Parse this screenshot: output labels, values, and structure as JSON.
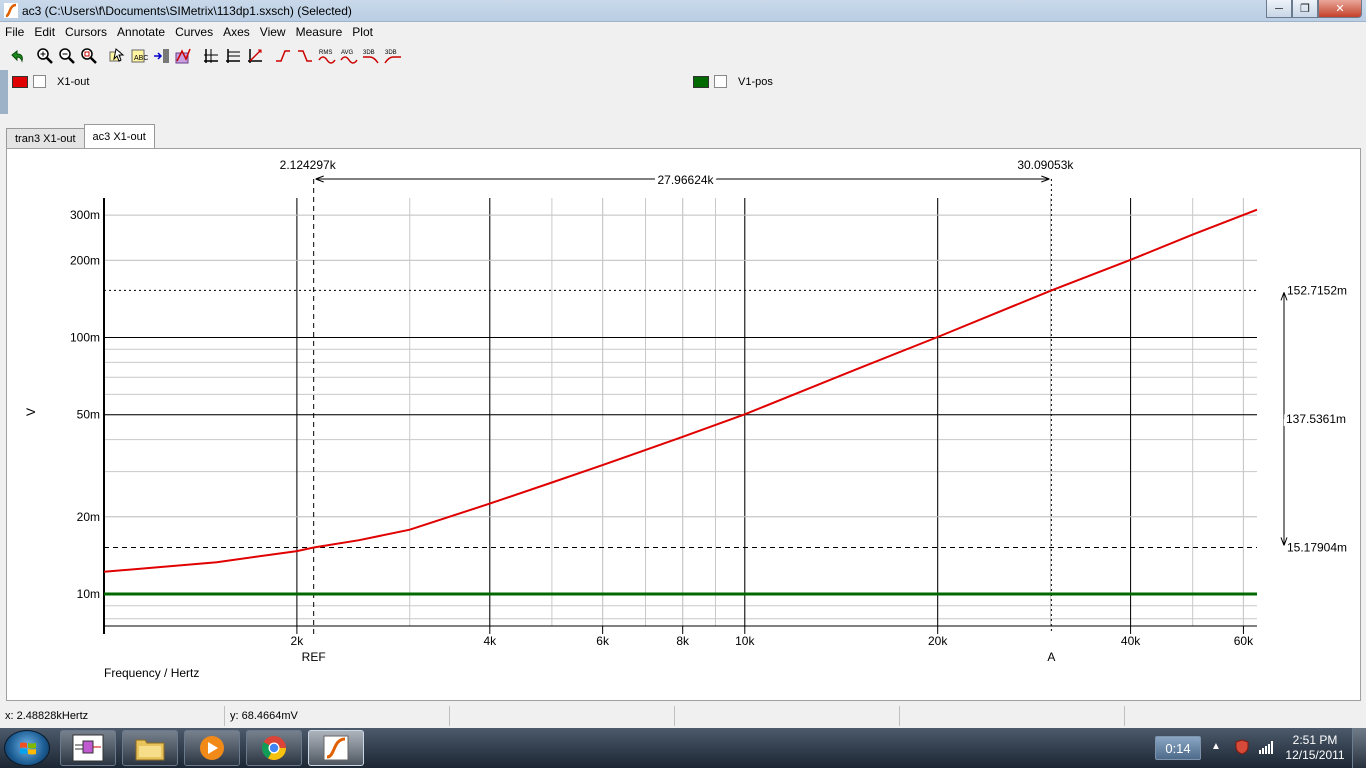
{
  "window": {
    "title": "ac3 (C:\\Users\\f\\Documents\\SIMetrix\\113dp1.sxsch) (Selected)",
    "min_label": "─",
    "max_label": "❐",
    "close_label": "✕"
  },
  "menu": [
    "File",
    "Edit",
    "Cursors",
    "Annotate",
    "Curves",
    "Axes",
    "View",
    "Measure",
    "Plot"
  ],
  "toolbar": {
    "icons": [
      "undo-icon",
      "zoom-in-icon",
      "zoom-out-icon",
      "zoom-fit-icon",
      "select-icon",
      "label-icon",
      "insert-icon",
      "axis-icon",
      "grid-icon",
      "log-icon",
      "cursor-icon",
      "rise-icon",
      "fall-icon",
      "rms-icon",
      "avg-icon",
      "3db-low-icon",
      "3db-high-icon"
    ],
    "rms_label": "RMS",
    "avg_label": "AVG",
    "db_label_1": "3DB",
    "db_label_2": "3DB"
  },
  "legend": [
    {
      "label": "X1-out",
      "color": "#e00000"
    },
    {
      "label": "V1-pos",
      "color": "#006a00"
    }
  ],
  "tabs": [
    "tran3 X1-out",
    "ac3 X1-out"
  ],
  "chart_data": {
    "type": "line",
    "x_scale": "log",
    "y_scale": "log",
    "xlabel": "Frequency / Hertz",
    "ylabel": "V",
    "xlim": [
      1000,
      63000
    ],
    "ylim": [
      0.0075,
      0.35
    ],
    "x_ticks": [
      {
        "value": 2000,
        "label": "2k"
      },
      {
        "value": 4000,
        "label": "4k"
      },
      {
        "value": 6000,
        "label": "6k"
      },
      {
        "value": 8000,
        "label": "8k"
      },
      {
        "value": 10000,
        "label": "10k"
      },
      {
        "value": 20000,
        "label": "20k"
      },
      {
        "value": 40000,
        "label": "40k"
      },
      {
        "value": 60000,
        "label": "60k"
      }
    ],
    "y_ticks": [
      {
        "value": 0.01,
        "label": "10m"
      },
      {
        "value": 0.02,
        "label": "20m"
      },
      {
        "value": 0.05,
        "label": "50m"
      },
      {
        "value": 0.1,
        "label": "100m"
      },
      {
        "value": 0.2,
        "label": "200m"
      },
      {
        "value": 0.3,
        "label": "300m"
      }
    ],
    "series": [
      {
        "name": "X1-out",
        "color": "#e00000",
        "x": [
          1000,
          1500,
          2000,
          2124.297,
          2500,
          3000,
          4000,
          5000,
          6000,
          8000,
          10000,
          15000,
          20000,
          30090.53,
          40000,
          50000,
          63000
        ],
        "y": [
          0.0122,
          0.0133,
          0.0147,
          0.01518,
          0.0162,
          0.0178,
          0.0225,
          0.0272,
          0.0318,
          0.041,
          0.0502,
          0.0755,
          0.1005,
          0.1527,
          0.201,
          0.252,
          0.315
        ]
      },
      {
        "name": "V1-pos",
        "color": "#006a00",
        "x": [
          1000,
          63000
        ],
        "y": [
          0.01,
          0.01
        ]
      }
    ],
    "cursors": {
      "ref": {
        "label": "REF",
        "x": 2124.297,
        "y": 0.01518,
        "x_label": "2.124297k",
        "y_label": "15.17904m"
      },
      "a": {
        "label": "A",
        "x": 30090.53,
        "y": 0.1527152,
        "x_label": "30.09053k",
        "y_label": "152.7152m"
      },
      "dx_label": "27.96624k",
      "dy_label": "137.5361m"
    }
  },
  "status": {
    "x_readout": "x: 2.48828kHertz",
    "y_readout": "y: 68.4664mV"
  },
  "taskbar": {
    "items": [
      "schematic-app-icon",
      "explorer-icon",
      "media-player-icon",
      "chrome-icon",
      "simetrix-icon"
    ],
    "lang": "0:14",
    "time": "2:51 PM",
    "date": "12/15/2011"
  }
}
